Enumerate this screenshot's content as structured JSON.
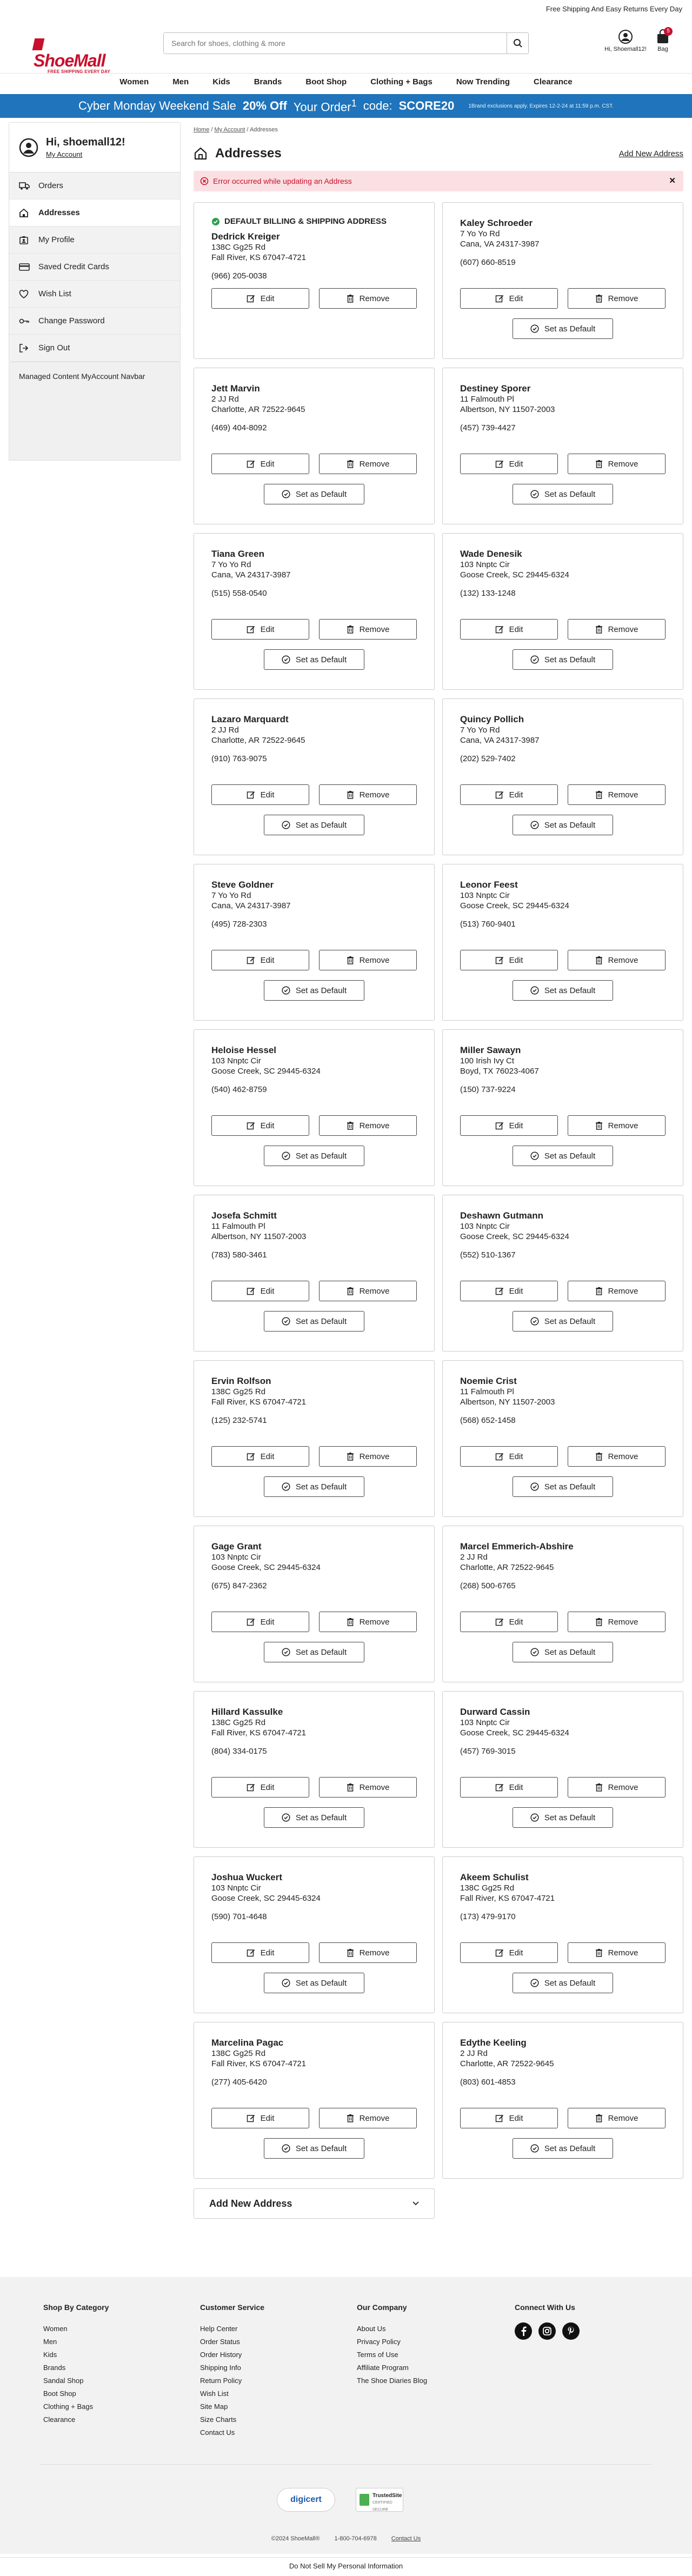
{
  "topbar": {
    "text": "Free Shipping And Easy Returns Every Day"
  },
  "header": {
    "logo_text": "ShoeMall",
    "logo_tagline": "FREE SHIPPING EVERY DAY",
    "search_placeholder": "Search for shoes, clothing & more",
    "account_label": "Hi, Shoemall12!",
    "bag_label": "Bag",
    "bag_count": "5"
  },
  "nav": [
    "Women",
    "Men",
    "Kids",
    "Brands",
    "Boot Shop",
    "Clothing + Bags",
    "Now Trending",
    "Clearance"
  ],
  "promo": {
    "part1": "Cyber Monday Weekend Sale",
    "part2": "20% Off",
    "part3": "Your Order",
    "sup": "1",
    "part4": "code:",
    "code": "SCORE20",
    "fine": "1Brand exclusions apply. Expires 12-2-24 at 11:59 p.m. CST."
  },
  "sidebar": {
    "greeting": "Hi, shoemall12!",
    "my_account": "My Account",
    "items": [
      {
        "label": "Orders",
        "icon": "truck-icon"
      },
      {
        "label": "Addresses",
        "icon": "home-icon"
      },
      {
        "label": "My Profile",
        "icon": "profile-icon"
      },
      {
        "label": "Saved Credit Cards",
        "icon": "credit-card-icon"
      },
      {
        "label": "Wish List",
        "icon": "heart-icon"
      },
      {
        "label": "Change Password",
        "icon": "key-icon"
      },
      {
        "label": "Sign Out",
        "icon": "sign-out-icon"
      }
    ],
    "managed": "Managed Content MyAccount Navbar"
  },
  "breadcrumb": {
    "home": "Home",
    "my_account": "My Account",
    "current": "Addresses"
  },
  "page": {
    "title": "Addresses",
    "add_link": "Add New Address",
    "error": "Error occurred while updating an Address",
    "default_label": "DEFAULT BILLING & SHIPPING ADDRESS",
    "edit_label": "Edit",
    "remove_label": "Remove",
    "set_default_label": "Set as Default",
    "add_accordion": "Add New Address"
  },
  "addresses": [
    {
      "name": "Dedrick Kreiger",
      "line1": "138C Gg25 Rd",
      "line2": "Fall River, KS 67047-4721",
      "phone": "(966) 205-0038",
      "default": true
    },
    {
      "name": "Kaley Schroeder",
      "line1": "7 Yo Yo Rd",
      "line2": "Cana, VA 24317-3987",
      "phone": "(607) 660-8519"
    },
    {
      "name": "Jett Marvin",
      "line1": "2 JJ Rd",
      "line2": "Charlotte, AR 72522-9645",
      "phone": "(469) 404-8092"
    },
    {
      "name": "Destiney Sporer",
      "line1": "11 Falmouth Pl",
      "line2": "Albertson, NY 11507-2003",
      "phone": "(457) 739-4427"
    },
    {
      "name": "Tiana Green",
      "line1": "7 Yo Yo Rd",
      "line2": "Cana, VA 24317-3987",
      "phone": "(515) 558-0540"
    },
    {
      "name": "Wade Denesik",
      "line1": "103 Nnptc Cir",
      "line2": "Goose Creek, SC 29445-6324",
      "phone": "(132) 133-1248"
    },
    {
      "name": "Lazaro Marquardt",
      "line1": "2 JJ Rd",
      "line2": "Charlotte, AR 72522-9645",
      "phone": "(910) 763-9075"
    },
    {
      "name": "Quincy Pollich",
      "line1": "7 Yo Yo Rd",
      "line2": "Cana, VA 24317-3987",
      "phone": "(202) 529-7402"
    },
    {
      "name": "Steve Goldner",
      "line1": "7 Yo Yo Rd",
      "line2": "Cana, VA 24317-3987",
      "phone": "(495) 728-2303"
    },
    {
      "name": "Leonor Feest",
      "line1": "103 Nnptc Cir",
      "line2": "Goose Creek, SC 29445-6324",
      "phone": "(513) 760-9401"
    },
    {
      "name": "Heloise Hessel",
      "line1": "103 Nnptc Cir",
      "line2": "Goose Creek, SC 29445-6324",
      "phone": "(540) 462-8759"
    },
    {
      "name": "Miller Sawayn",
      "line1": "100 Irish Ivy Ct",
      "line2": "Boyd, TX 76023-4067",
      "phone": "(150) 737-9224"
    },
    {
      "name": "Josefa Schmitt",
      "line1": "11 Falmouth Pl",
      "line2": "Albertson, NY 11507-2003",
      "phone": "(783) 580-3461"
    },
    {
      "name": "Deshawn Gutmann",
      "line1": "103 Nnptc Cir",
      "line2": "Goose Creek, SC 29445-6324",
      "phone": "(552) 510-1367"
    },
    {
      "name": "Ervin Rolfson",
      "line1": "138C Gg25 Rd",
      "line2": "Fall River, KS 67047-4721",
      "phone": "(125) 232-5741"
    },
    {
      "name": "Noemie Crist",
      "line1": "11 Falmouth Pl",
      "line2": "Albertson, NY 11507-2003",
      "phone": "(568) 652-1458"
    },
    {
      "name": "Gage Grant",
      "line1": "103 Nnptc Cir",
      "line2": "Goose Creek, SC 29445-6324",
      "phone": "(675) 847-2362"
    },
    {
      "name": "Marcel Emmerich-Abshire",
      "line1": "2 JJ Rd",
      "line2": "Charlotte, AR 72522-9645",
      "phone": "(268) 500-6765"
    },
    {
      "name": "Hillard Kassulke",
      "line1": "138C Gg25 Rd",
      "line2": "Fall River, KS 67047-4721",
      "phone": "(804) 334-0175"
    },
    {
      "name": "Durward Cassin",
      "line1": "103 Nnptc Cir",
      "line2": "Goose Creek, SC 29445-6324",
      "phone": "(457) 769-3015"
    },
    {
      "name": "Joshua Wuckert",
      "line1": "103 Nnptc Cir",
      "line2": "Goose Creek, SC 29445-6324",
      "phone": "(590) 701-4648"
    },
    {
      "name": "Akeem Schulist",
      "line1": "138C Gg25 Rd",
      "line2": "Fall River, KS 67047-4721",
      "phone": "(173) 479-9170"
    },
    {
      "name": "Marcelina Pagac",
      "line1": "138C Gg25 Rd",
      "line2": "Fall River, KS 67047-4721",
      "phone": "(277) 405-6420"
    },
    {
      "name": "Edythe Keeling",
      "line1": "2 JJ Rd",
      "line2": "Charlotte, AR 72522-9645",
      "phone": "(803) 601-4853"
    }
  ],
  "footer": {
    "cols": [
      {
        "title": "Shop By Category",
        "items": [
          "Women",
          "Men",
          "Kids",
          "Brands",
          "Sandal Shop",
          "Boot Shop",
          "Clothing + Bags",
          "Clearance"
        ]
      },
      {
        "title": "Customer Service",
        "items": [
          "Help Center",
          "Order Status",
          "Order History",
          "Shipping Info",
          "Return Policy",
          "Wish List",
          "Site Map",
          "Size Charts",
          "Contact Us"
        ]
      },
      {
        "title": "Our Company",
        "items": [
          "About Us",
          "Privacy Policy",
          "Terms of Use",
          "Affiliate Program",
          "The Shoe Diaries Blog"
        ]
      }
    ],
    "connect_title": "Connect With Us",
    "digicert": "digicert",
    "trustedsite_1": "TrustedSite",
    "trustedsite_2": "CERTIFIED SECURE",
    "copyright": "©2024 ShoeMall®",
    "phone": "1-800-704-6978",
    "contact": "Contact Us",
    "bottom": "Do Not Sell My Personal Information"
  },
  "colors": {
    "brand_red": "#c8102e",
    "promo_blue": "#1f74bb",
    "error_bg": "#fbe0e3"
  }
}
